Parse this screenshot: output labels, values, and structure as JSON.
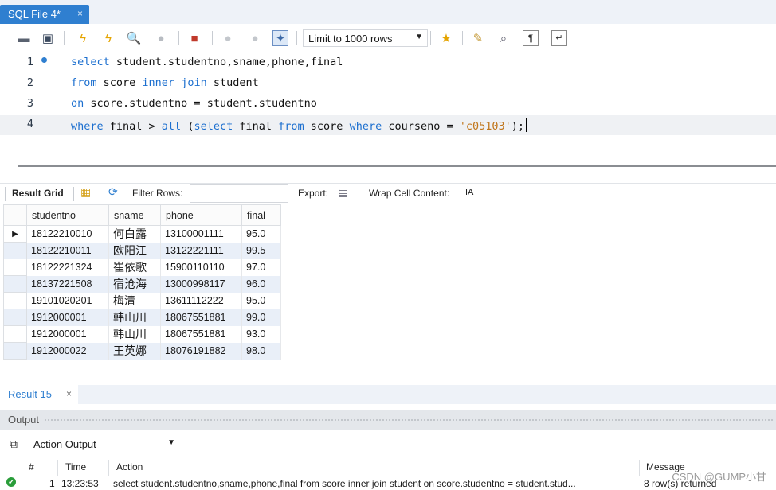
{
  "tab": {
    "title": "SQL File 4*",
    "close": "×"
  },
  "toolbar": {
    "limit_value": "Limit to 1000 rows"
  },
  "editor": {
    "lines": [
      {
        "number": "1"
      },
      {
        "number": "2"
      },
      {
        "number": "3"
      },
      {
        "number": "4"
      }
    ],
    "tokens": {
      "l1_kw": "select",
      "l1_rest": " student.studentno,sname,phone,final",
      "l2_kw1": "from",
      "l2_mid": " score ",
      "l2_kw2": "inner join",
      "l2_rest": " student",
      "l3_kw": "on",
      "l3_rest": " score.studentno = student.studentno",
      "l4_kw1": "where",
      "l4_a": " final > ",
      "l4_kw2": "all",
      "l4_b": " (",
      "l4_kw3": "select",
      "l4_c": " final ",
      "l4_kw4": "from",
      "l4_d": " score ",
      "l4_kw5": "where",
      "l4_e": " courseno = ",
      "l4_str": "'c05103'",
      "l4_end": ");"
    }
  },
  "result_bar": {
    "result_grid": "Result Grid",
    "filter_rows": "Filter Rows:",
    "export": "Export:",
    "wrap_cell": "Wrap Cell Content:"
  },
  "grid": {
    "columns": [
      "studentno",
      "sname",
      "phone",
      "final"
    ],
    "rows": [
      [
        "18122210010",
        "何白露",
        "13100001111",
        "95.0"
      ],
      [
        "18122210011",
        "欧阳江",
        "13122221111",
        "99.5"
      ],
      [
        "18122221324",
        "崔依歌",
        "15900110110",
        "97.0"
      ],
      [
        "18137221508",
        "宿沧海",
        "13000998117",
        "96.0"
      ],
      [
        "19101020201",
        "梅清",
        "13611112222",
        "95.0"
      ],
      [
        "1912000001",
        "韩山川",
        "18067551881",
        "99.0"
      ],
      [
        "1912000001",
        "韩山川",
        "18067551881",
        "93.0"
      ],
      [
        "1912000022",
        "王英娜",
        "18076191882",
        "98.0"
      ]
    ]
  },
  "result_tab": {
    "label": "Result 15",
    "close": "×"
  },
  "output": {
    "header": "Output",
    "selector": "Action Output",
    "columns": {
      "num": "#",
      "time": "Time",
      "action": "Action",
      "message": "Message"
    },
    "row": {
      "num": "1",
      "time": "13:23:53",
      "action": "select student.studentno,sname,phone,final  from score inner join student  on score.studentno = student.stud...",
      "message": "8 row(s) returned"
    }
  },
  "watermark": "CSDN @GUMP小甘",
  "colors": {
    "accent": "#2f7fd0",
    "keyword": "#1c6fcf",
    "string": "#c1761b",
    "row_alt": "#e9eff8",
    "success": "#2a9d3a"
  }
}
